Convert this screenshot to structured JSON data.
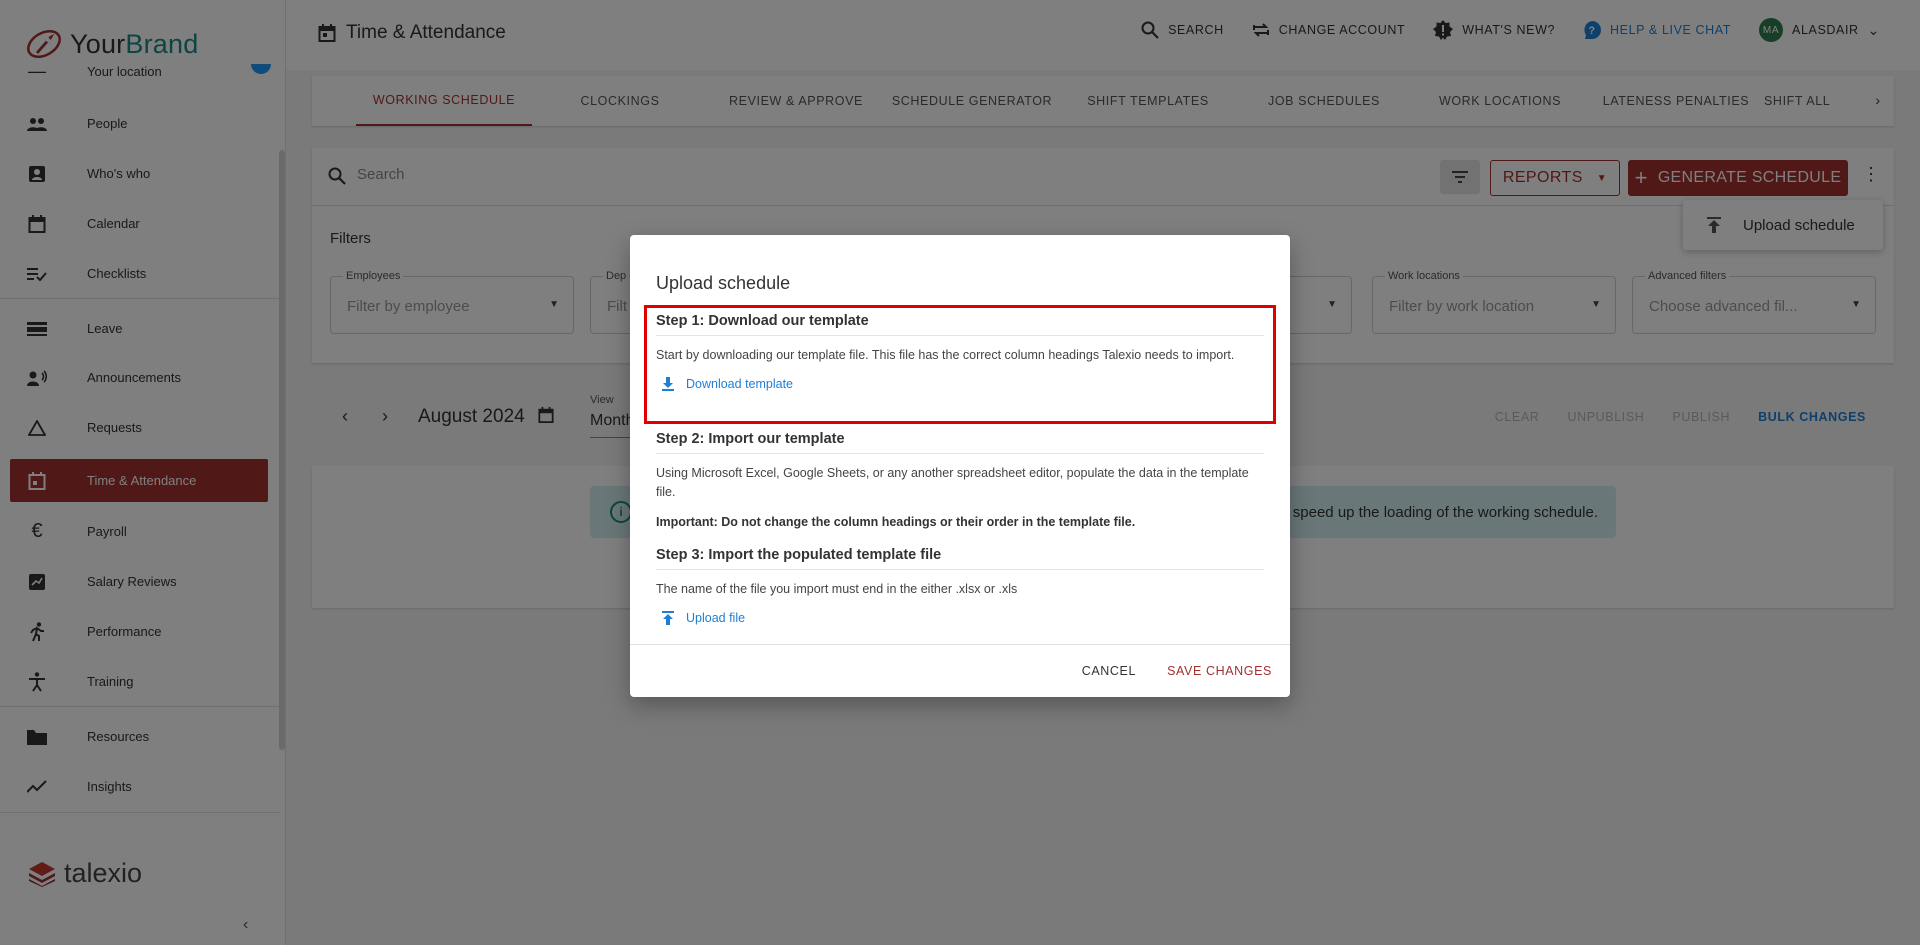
{
  "brand": {
    "name_part1": "Your",
    "name_part2": "Brand"
  },
  "sidebar": {
    "partial_top": "Your location",
    "items": [
      {
        "label": "People",
        "icon": "people-icon"
      },
      {
        "label": "Who's who",
        "icon": "contact-card-icon"
      },
      {
        "label": "Calendar",
        "icon": "calendar-icon"
      },
      {
        "label": "Checklists",
        "icon": "checklist-icon"
      },
      {
        "label": "Leave",
        "icon": "leave-icon"
      },
      {
        "label": "Announcements",
        "icon": "announcement-icon"
      },
      {
        "label": "Requests",
        "icon": "triangle-icon"
      },
      {
        "label": "Time & Attendance",
        "icon": "calendar-clock-icon"
      },
      {
        "label": "Payroll",
        "icon": "euro-icon"
      },
      {
        "label": "Salary Reviews",
        "icon": "salary-icon"
      },
      {
        "label": "Performance",
        "icon": "running-icon"
      },
      {
        "label": "Training",
        "icon": "training-icon"
      },
      {
        "label": "Resources",
        "icon": "folder-icon"
      },
      {
        "label": "Insights",
        "icon": "trend-icon"
      }
    ],
    "footer_brand": "talexio"
  },
  "header": {
    "title": "Time & Attendance",
    "search": "SEARCH",
    "change_account": "CHANGE ACCOUNT",
    "whats_new": "WHAT'S NEW?",
    "help": "HELP & LIVE CHAT",
    "avatar_initials": "MA",
    "user": "ALASDAIR"
  },
  "tabs": [
    "WORKING SCHEDULE",
    "CLOCKINGS",
    "REVIEW & APPROVE",
    "SCHEDULE GENERATOR",
    "SHIFT TEMPLATES",
    "JOB SCHEDULES",
    "WORK LOCATIONS",
    "LATENESS PENALTIES",
    "SHIFT ALL"
  ],
  "toolbar": {
    "search_placeholder": "Search",
    "reports": "REPORTS",
    "generate": "GENERATE SCHEDULE"
  },
  "filters": {
    "title": "Filters",
    "employees": {
      "label": "Employees",
      "placeholder": "Filter by employee"
    },
    "departments": {
      "label": "Dep",
      "placeholder": "Filt"
    },
    "work_locations": {
      "label": "Work locations",
      "placeholder": "Filter by work location"
    },
    "advanced": {
      "label": "Advanced filters",
      "placeholder": "Choose advanced fil..."
    }
  },
  "calendar": {
    "month": "August 2024",
    "view_label": "View",
    "view_value": "Month",
    "clear": "CLEAR",
    "unpublish": "UNPUBLISH",
    "publish": "PUBLISH",
    "bulk": "BULK CHANGES"
  },
  "info_text": "speed up the loading of the working schedule.",
  "menu": {
    "upload": "Upload schedule"
  },
  "modal": {
    "title": "Upload schedule",
    "step1_title": "Step 1: Download our template",
    "step1_text": "Start by downloading our template file. This file has the correct column headings Talexio needs to import.",
    "step1_link": "Download template",
    "step2_title": "Step 2: Import our template",
    "step2_text": "Using Microsoft Excel, Google Sheets, or any another spreadsheet editor, populate the data in the template file.",
    "step2_important": "Important: Do not change the column headings or their order in the template file.",
    "step3_title": "Step 3: Import the populated template file",
    "step3_text": "The name of the file you import must end in the either .xlsx or .xls",
    "step3_link": "Upload file",
    "cancel": "CANCEL",
    "save": "SAVE CHANGES"
  },
  "colors": {
    "accent": "#a33030",
    "link": "#1e7fd6",
    "teal": "#1a8a86",
    "highlight": "#e00000"
  }
}
